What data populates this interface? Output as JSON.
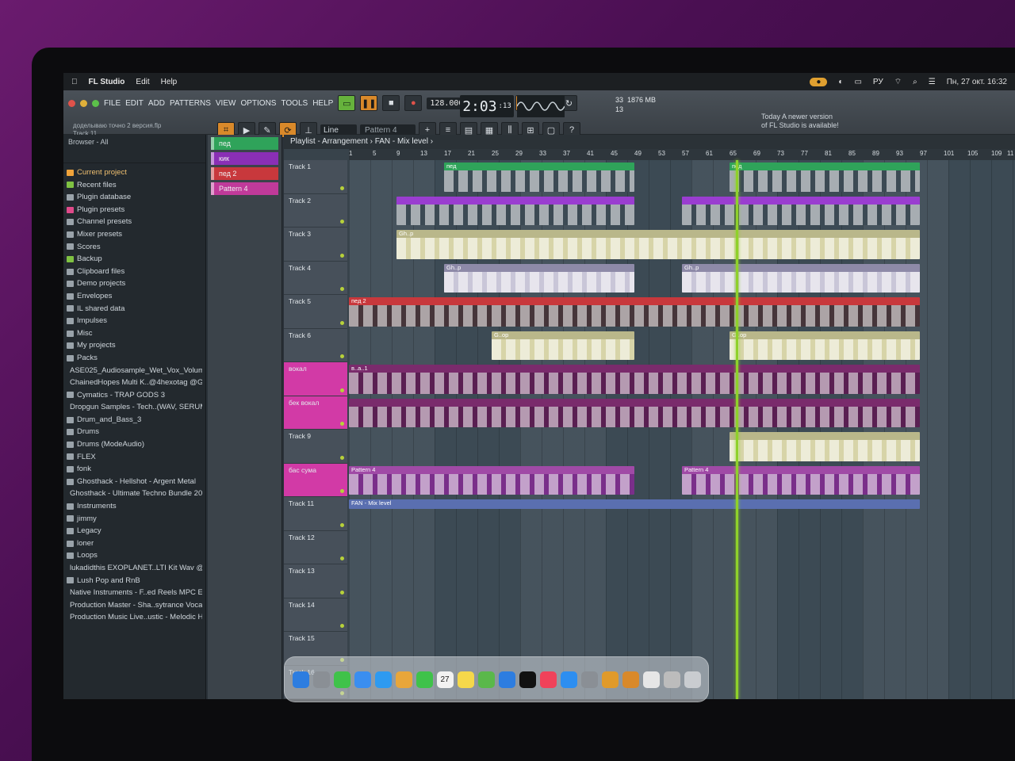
{
  "menubar": {
    "date_time": "Пн, 27 окт.  16:32",
    "lang": "РУ"
  },
  "app_menu": {
    "app_name": "FL Studio",
    "items": [
      "Edit",
      "Help"
    ]
  },
  "fl_menu": [
    "FILE",
    "EDIT",
    "ADD",
    "PATTERNS",
    "VIEW",
    "OPTIONS",
    "TOOLS",
    "HELP"
  ],
  "transport": {
    "tempo": "128.000",
    "time": "2:03",
    "time_sub": ":13",
    "time_unit": "M:S:CS",
    "cpu": "33",
    "memory": "1876 MB",
    "voices": "13"
  },
  "news": {
    "line1": "Today  A newer version",
    "line2": "of FL Studio is available!"
  },
  "project": {
    "name": "доделываю точно 2 версия.flp",
    "hint": "Track 11"
  },
  "snap": "Line",
  "pattern_selector": "Pattern 4",
  "playlist_title": "Playlist - Arrangement › FAN - Mix level ›",
  "browser": {
    "title": "Browser - All",
    "items": [
      {
        "label": "Current project",
        "color": "#f0a33a"
      },
      {
        "label": "Recent files",
        "color": "#7fc242"
      },
      {
        "label": "Plugin database",
        "color": "#9aa3aa"
      },
      {
        "label": "Plugin presets",
        "color": "#e04a8a"
      },
      {
        "label": "Channel presets",
        "color": "#9aa3aa"
      },
      {
        "label": "Mixer presets",
        "color": "#9aa3aa"
      },
      {
        "label": "Scores",
        "color": "#9aa3aa"
      },
      {
        "label": "Backup",
        "color": "#7fc242"
      },
      {
        "label": "Clipboard files",
        "color": "#9aa3aa"
      },
      {
        "label": "Demo projects",
        "color": "#9aa3aa"
      },
      {
        "label": "Envelopes",
        "color": "#9aa3aa"
      },
      {
        "label": "IL shared data",
        "color": "#9aa3aa"
      },
      {
        "label": "Impulses",
        "color": "#9aa3aa"
      },
      {
        "label": "Misc",
        "color": "#9aa3aa"
      },
      {
        "label": "My projects",
        "color": "#9aa3aa"
      },
      {
        "label": "Packs",
        "color": "#9aa3aa"
      },
      {
        "label": "ASE025_Audiosample_Wet_Vox_Volume_2",
        "color": "#9aa3aa"
      },
      {
        "label": "ChainedHopes Multi K..@4hexotag @Goat_Kits",
        "color": "#9aa3aa"
      },
      {
        "label": "Cymatics - TRAP GODS 3",
        "color": "#9aa3aa"
      },
      {
        "label": "Dropgun Samples - Tech..(WAV, SERUM) [2024]",
        "color": "#9aa3aa"
      },
      {
        "label": "Drum_and_Bass_3",
        "color": "#9aa3aa"
      },
      {
        "label": "Drums",
        "color": "#9aa3aa"
      },
      {
        "label": "Drums (ModeAudio)",
        "color": "#9aa3aa"
      },
      {
        "label": "FLEX",
        "color": "#9aa3aa"
      },
      {
        "label": "fonk",
        "color": "#9aa3aa"
      },
      {
        "label": "Ghosthack - Hellshot - Argent Metal",
        "color": "#9aa3aa"
      },
      {
        "label": "Ghosthack - Ultimate Techno Bundle 2025",
        "color": "#9aa3aa"
      },
      {
        "label": "Instruments",
        "color": "#9aa3aa"
      },
      {
        "label": "jimmy",
        "color": "#9aa3aa"
      },
      {
        "label": "Legacy",
        "color": "#9aa3aa"
      },
      {
        "label": "loner",
        "color": "#9aa3aa"
      },
      {
        "label": "Loops",
        "color": "#9aa3aa"
      },
      {
        "label": "lukadidthis EXOPLANET..LTI Kit Wav @Goat_Kits",
        "color": "#9aa3aa"
      },
      {
        "label": "Lush Pop and RnB",
        "color": "#9aa3aa"
      },
      {
        "label": "Native Instruments - F..ed Reels MPC Expansion",
        "color": "#9aa3aa"
      },
      {
        "label": "Production Master - Sha..sytrance Vocals (2022)",
        "color": "#9aa3aa"
      },
      {
        "label": "Production Music Live..ustic - Melodic House 4",
        "color": "#9aa3aa"
      }
    ]
  },
  "patterns": [
    {
      "label": "пед",
      "color": "#2fa35a"
    },
    {
      "label": "кик",
      "color": "#8a2fb5"
    },
    {
      "label": "пед 2",
      "color": "#c8383c"
    },
    {
      "label": "Pattern 4",
      "color": "#c03a9a"
    }
  ],
  "ruler": [
    "1",
    "5",
    "9",
    "13",
    "17",
    "21",
    "25",
    "29",
    "33",
    "37",
    "41",
    "45",
    "49",
    "53",
    "57",
    "61",
    "65",
    "69",
    "73",
    "77",
    "81",
    "85",
    "89",
    "93",
    "97",
    "101",
    "105",
    "109",
    "11"
  ],
  "tracks": [
    {
      "label": "Track 1",
      "color": "#47505a"
    },
    {
      "label": "Track 2",
      "color": "#47505a"
    },
    {
      "label": "Track 3",
      "color": "#47505a"
    },
    {
      "label": "Track 4",
      "color": "#47505a"
    },
    {
      "label": "Track 5",
      "color": "#47505a"
    },
    {
      "label": "Track 6",
      "color": "#47505a"
    },
    {
      "label": "вокал",
      "color": "#d23aa6"
    },
    {
      "label": "бек вокал",
      "color": "#d23aa6"
    },
    {
      "label": "Track 9",
      "color": "#47505a"
    },
    {
      "label": "бас сума",
      "color": "#d23aa6"
    },
    {
      "label": "Track 11",
      "color": "#47505a"
    },
    {
      "label": "Track 12",
      "color": "#47505a"
    },
    {
      "label": "Track 13",
      "color": "#47505a"
    },
    {
      "label": "Track 14",
      "color": "#47505a"
    },
    {
      "label": "Track 15",
      "color": "#47505a"
    },
    {
      "label": "Track 16",
      "color": "#47505a"
    }
  ],
  "clips": [
    {
      "track": 0,
      "label": "пед",
      "color": "#2fa35a",
      "body": "#3c4a54",
      "ranges": [
        [
          17,
          49
        ],
        [
          65,
          97
        ]
      ]
    },
    {
      "track": 1,
      "label": "",
      "color": "#9a3dd0",
      "body": "#3c4a54",
      "ranges": [
        [
          9,
          49
        ],
        [
          57,
          97
        ]
      ]
    },
    {
      "track": 2,
      "label": "Gh..p",
      "color": "#b9b78a",
      "body": "#d7d4a8",
      "ranges": [
        [
          9,
          97
        ]
      ]
    },
    {
      "track": 3,
      "label": "Gh..p",
      "color": "#8e8aa8",
      "body": "#c9c6d8",
      "ranges": [
        [
          17,
          49
        ],
        [
          57,
          97
        ]
      ]
    },
    {
      "track": 4,
      "label": "пед 2",
      "color": "#c8383c",
      "body": "#46353a",
      "ranges": [
        [
          1,
          97
        ]
      ]
    },
    {
      "track": 5,
      "label": "G..op",
      "color": "#b9b78a",
      "body": "#d7d4a8",
      "ranges": [
        [
          25,
          49
        ],
        [
          65,
          97
        ]
      ]
    },
    {
      "track": 6,
      "label": "в..a..1",
      "color": "#7a2b6c",
      "body": "#5a1f52",
      "ranges": [
        [
          1,
          97
        ]
      ]
    },
    {
      "track": 7,
      "label": "",
      "color": "#7a2b6c",
      "body": "#5a1f52",
      "ranges": [
        [
          1,
          97
        ]
      ]
    },
    {
      "track": 8,
      "label": "",
      "color": "#b9b78a",
      "body": "#d7d4a8",
      "ranges": [
        [
          65,
          97
        ]
      ]
    },
    {
      "track": 9,
      "label": "Pattern 4",
      "color": "#a04aa6",
      "body": "#7a2f8a",
      "ranges": [
        [
          1,
          49
        ],
        [
          57,
          97
        ]
      ]
    }
  ],
  "automation": {
    "label": "FAN - Mix level",
    "color": "#5a6fb0"
  },
  "dock": [
    {
      "icon": "finder-icon",
      "color": "#2d7de0"
    },
    {
      "icon": "launchpad-icon",
      "color": "#8a8f95"
    },
    {
      "icon": "messages-icon",
      "color": "#3fc24a"
    },
    {
      "icon": "mail-icon",
      "color": "#3a8ef0"
    },
    {
      "icon": "safari-icon",
      "color": "#2e9af0"
    },
    {
      "icon": "photos-icon",
      "color": "#e8a63a"
    },
    {
      "icon": "facetime-icon",
      "color": "#3fc24a"
    },
    {
      "icon": "calendar-icon",
      "color": "#f2f2f2"
    },
    {
      "icon": "notes-icon",
      "color": "#f5d84a"
    },
    {
      "icon": "maps-icon",
      "color": "#5ab84a"
    },
    {
      "icon": "books-icon",
      "color": "#2d7de0"
    },
    {
      "icon": "tv-icon",
      "color": "#111111"
    },
    {
      "icon": "music-icon",
      "color": "#f0425a"
    },
    {
      "icon": "appstore-icon",
      "color": "#2d8ef0"
    },
    {
      "icon": "settings-icon",
      "color": "#8a8f95"
    },
    {
      "icon": "fl-studio-icon",
      "color": "#e09a2a"
    },
    {
      "icon": "flstudio2-icon",
      "color": "#d9892a"
    },
    {
      "icon": "document-icon",
      "color": "#e6e6e6"
    },
    {
      "icon": "preview-icon",
      "color": "#bcbcbc"
    },
    {
      "icon": "trash-icon",
      "color": "#c9ccd0"
    }
  ],
  "calendar_day": "27"
}
